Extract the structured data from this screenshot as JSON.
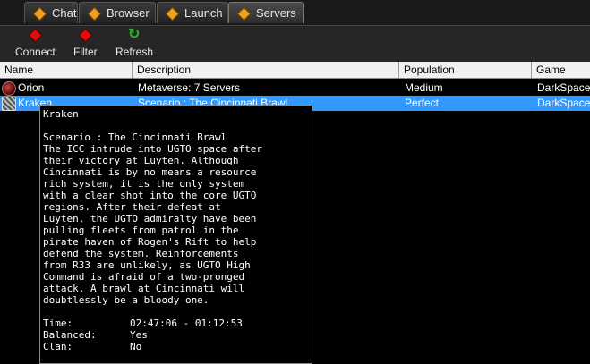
{
  "tabs": [
    {
      "label": "Chat",
      "active": false
    },
    {
      "label": "Browser",
      "active": false
    },
    {
      "label": "Launch",
      "active": false
    },
    {
      "label": "Servers",
      "active": true
    }
  ],
  "toolbar": {
    "connect_label": "Connect",
    "filter_label": "Filter",
    "refresh_label": "Refresh"
  },
  "columns": [
    "Name",
    "Description",
    "Population",
    "Game"
  ],
  "rows": [
    {
      "name": "Orion",
      "description": "Metaverse: 7 Servers",
      "population": "Medium",
      "game": "DarkSpace",
      "icon": "server-globe-icon"
    },
    {
      "name": "Kraken",
      "description": "Scenario : The Cincinnati Brawl",
      "population": "Perfect",
      "game": "DarkSpace",
      "icon": "server-scenario-icon",
      "selected": true
    }
  ],
  "tooltip": {
    "title": "Kraken",
    "scenario": "Scenario : The Cincinnati Brawl",
    "lines": [
      "The ICC intrude into UGTO space after",
      "their victory at Luyten. Although",
      "Cincinnati is by no means a resource",
      "rich system, it is the only system",
      "with a clear shot into the core UGTO",
      "regions. After their defeat at",
      "Luyten, the UGTO admiralty have been",
      "pulling fleets from patrol in the",
      "pirate haven of Rogen's Rift to help",
      "defend the system. Reinforcements",
      "from R33 are unlikely, as UGTO High",
      "Command is afraid of a two-pronged",
      "attack. A brawl at Cincinnati will",
      "doubtlessly be a bloody one."
    ],
    "time_label": "Time:",
    "time_value": "02:47:06 - 01:12:53",
    "balanced_label": "Balanced:",
    "balanced_value": "Yes",
    "clan_label": "Clan:",
    "clan_value": "No"
  },
  "colors": {
    "selection": "#3399ff",
    "tab_icon": "#f0a020",
    "toolbar_icon": "#e01010",
    "refresh_icon": "#2fb02f"
  }
}
